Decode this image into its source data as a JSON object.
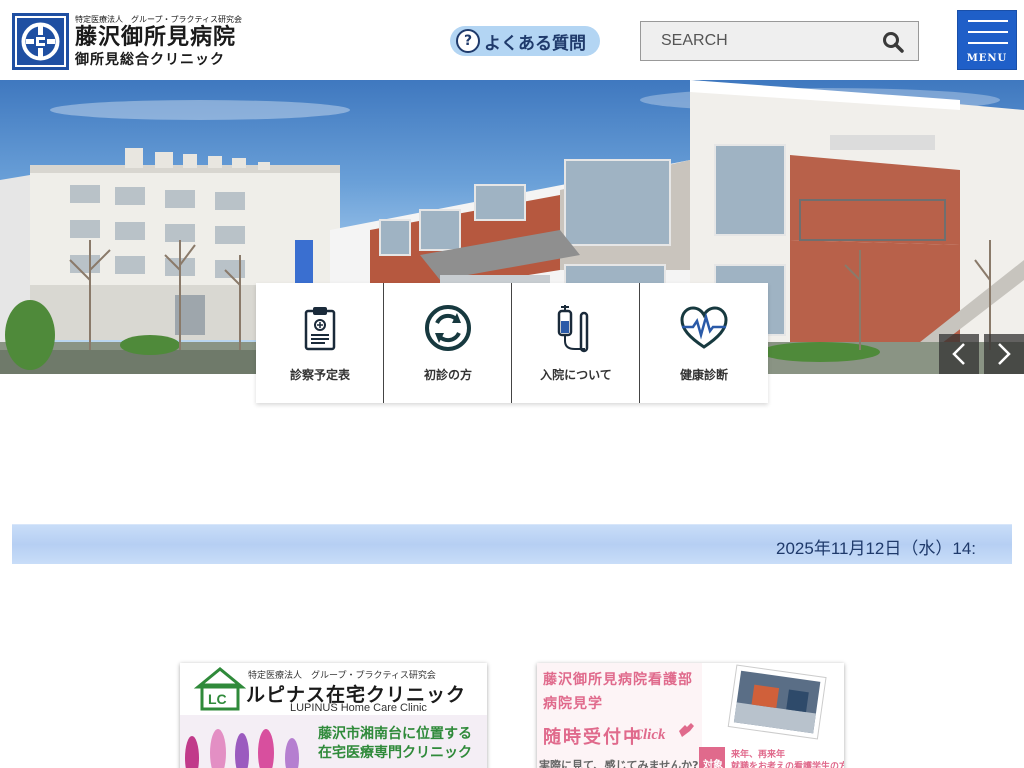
{
  "header": {
    "logo": {
      "subtitle": "特定医療法人　グループ・プラクティス研究会",
      "hospital_name": "藤沢御所見病院",
      "clinic_name": "御所見総合クリニック"
    },
    "faq_label": "よくある質問",
    "search_placeholder": "SEARCH",
    "menu_label": "MENU"
  },
  "quick_nav": [
    {
      "label": "診察予定表",
      "icon": "clipboard-icon"
    },
    {
      "label": "初診の方",
      "icon": "refresh-cycle-icon"
    },
    {
      "label": "入院について",
      "icon": "iv-drip-icon"
    },
    {
      "label": "健康診断",
      "icon": "heart-pulse-icon"
    }
  ],
  "ticker": {
    "text": "2025年11月12日（水）14:"
  },
  "banners": {
    "left": {
      "org": "特定医療法人　グループ・プラクティス研究会",
      "title": "ルピナス在宅クリニック",
      "title_en": "LUPINUS Home Care Clinic",
      "desc1": "藤沢市湘南台に位置する",
      "desc2": "在宅医療専門クリニック"
    },
    "right": {
      "line1": "藤沢御所見病院看護部",
      "line2": "病院見学",
      "line3": "随時受付中",
      "click": "Click",
      "target_tag": "対象",
      "target1": "来年、再来年",
      "target2": "就職をお考えの看護学生の方",
      "bottom": "実際に見て、感じてみませんか?"
    }
  },
  "colors": {
    "brand_blue": "#1f4fa2",
    "menu_blue": "#1f5fc8",
    "faq_bg": "#b3d5f3",
    "ticker_bg": "#c2d8f6",
    "banner_pink": "#e06a8c",
    "banner_green": "#2f8a3a"
  }
}
